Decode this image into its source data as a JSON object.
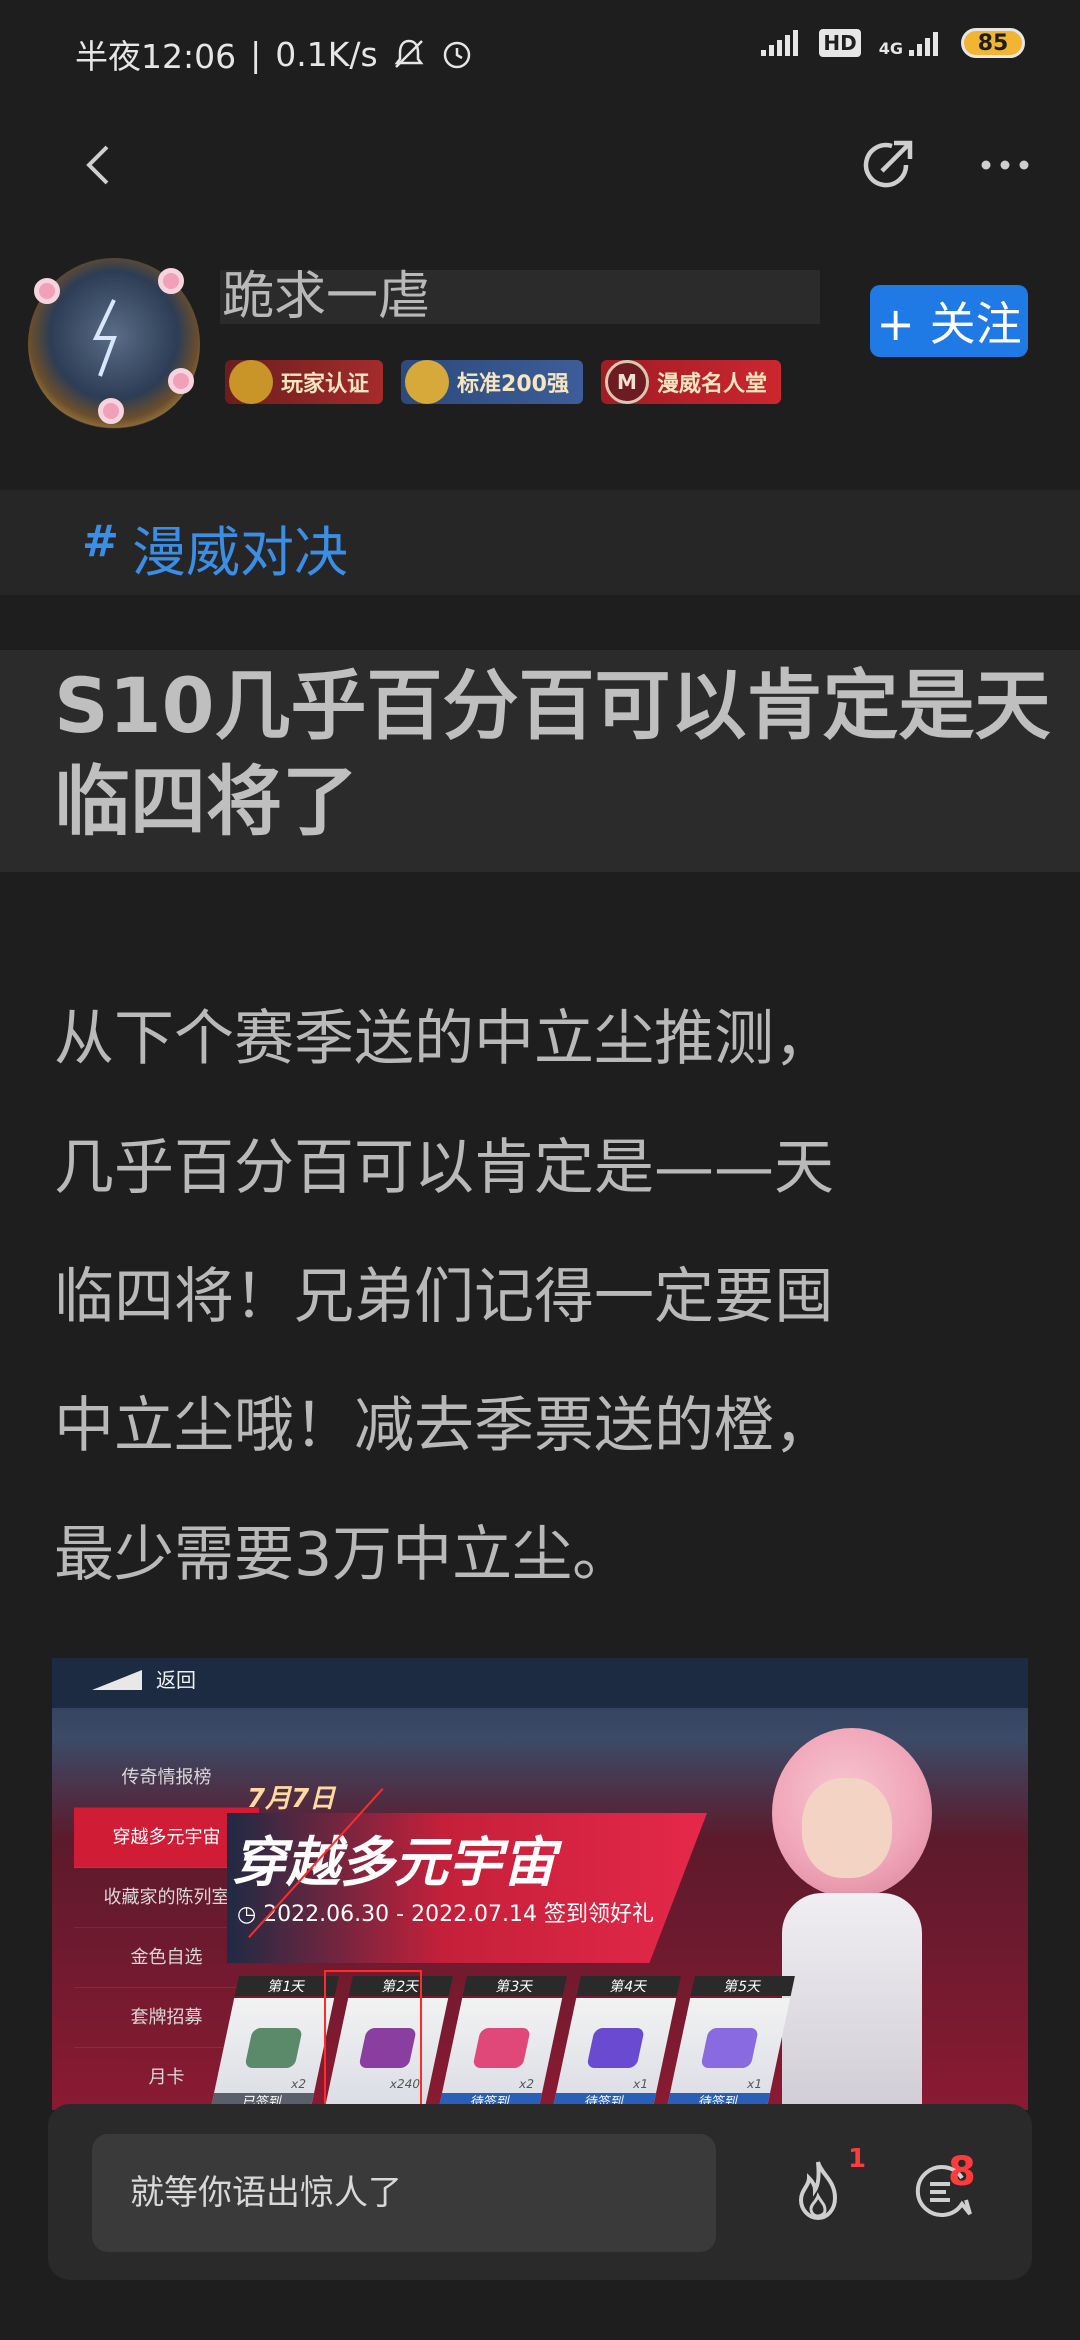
{
  "status_bar": {
    "time": "半夜12:06",
    "speed": "0.1K/s",
    "hd": "HD",
    "network": "4G",
    "battery": "85"
  },
  "author": {
    "username": "跪求一虐",
    "badges": [
      "玩家认证",
      "标准200强",
      "漫威名人堂"
    ],
    "badge3_icon_text": "M",
    "follow_label": "+ 关注"
  },
  "topic": {
    "hash": "#",
    "name": "漫威对决"
  },
  "post": {
    "title": "S10几乎百分百可以肯定是天临四将了",
    "body_lines": [
      "从下个赛季送的中立尘推测，",
      "几乎百分百可以肯定是——天",
      "临四将！兄弟们记得一定要囤",
      "中立尘哦！减去季票送的橙，",
      "最少需要3万中立尘。"
    ]
  },
  "post_image": {
    "back_label": "返回",
    "menu": [
      "传奇情报榜",
      "穿越多元宇宙",
      "收藏家的陈列室",
      "金色自选",
      "套牌招募",
      "月卡"
    ],
    "active_menu_index": 1,
    "date_tag": "7月7日",
    "headline": "穿越多元宇宙",
    "date_range": "◷ 2022.06.30 - 2022.07.14  签到领好礼",
    "cards": [
      {
        "day": "第1天",
        "count": "x2",
        "status": "已签到",
        "color": "#5b8a6b"
      },
      {
        "day": "第2天",
        "count": "x240",
        "status": "",
        "color": "#8a3fa0"
      },
      {
        "day": "第3天",
        "count": "x2",
        "status": "待签到",
        "color": "#e0487a"
      },
      {
        "day": "第4天",
        "count": "x1",
        "status": "待签到",
        "color": "#6a4ad0"
      },
      {
        "day": "第5天",
        "count": "x1",
        "status": "待签到",
        "color": "#8a6ae0"
      }
    ]
  },
  "comment_bar": {
    "placeholder": "就等你语出惊人了",
    "like_count": "1",
    "comment_count": "8"
  },
  "colors": {
    "background": "#1e1e1e",
    "accent_blue": "#1f7ae6",
    "topic_blue": "#3a8ee6",
    "alert_red": "#ff3b3b"
  }
}
